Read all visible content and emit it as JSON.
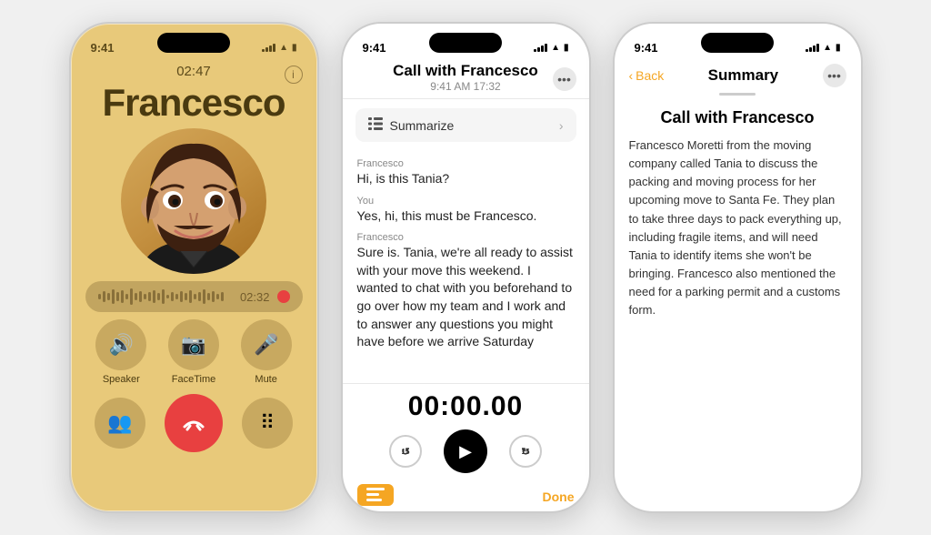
{
  "phone1": {
    "time": "9:41",
    "call_timer": "02:47",
    "caller_name": "Francesco",
    "waveform_timer": "02:32",
    "info_label": "i",
    "controls": [
      {
        "icon": "🔊",
        "label": "Speaker"
      },
      {
        "icon": "📹",
        "label": "FaceTime"
      },
      {
        "icon": "🎤",
        "label": "Mute"
      }
    ],
    "bottom_controls": [
      {
        "icon": "👤",
        "label": ""
      },
      {
        "icon": "📞",
        "label": "",
        "type": "end"
      },
      {
        "icon": "⠿",
        "label": ""
      }
    ]
  },
  "phone2": {
    "time": "9:41",
    "title": "Call with Francesco",
    "subtitle": "9:41 AM  17:32",
    "summarize_label": "Summarize",
    "messages": [
      {
        "speaker": "Francesco",
        "text": "Hi, is this Tania?"
      },
      {
        "speaker": "You",
        "text": "Yes, hi, this must be Francesco."
      },
      {
        "speaker": "Francesco",
        "text": "Sure is. Tania, we're all ready to assist with your move this weekend. I wanted to chat with you beforehand to go over how my team and I work and to answer any questions you might have before we arrive Saturday"
      }
    ],
    "playback_time": "00:00.00",
    "done_label": "Done"
  },
  "phone3": {
    "time": "9:41",
    "back_label": "Back",
    "nav_title": "Summary",
    "call_title": "Call with Francesco",
    "summary_text": "Francesco Moretti from the moving company called Tania to discuss the packing and moving process for her upcoming move to Santa Fe. They plan to take three days to pack everything up, including fragile items, and will need Tania to identify items she won't be bringing. Francesco also mentioned the need for a parking permit and a customs form."
  }
}
